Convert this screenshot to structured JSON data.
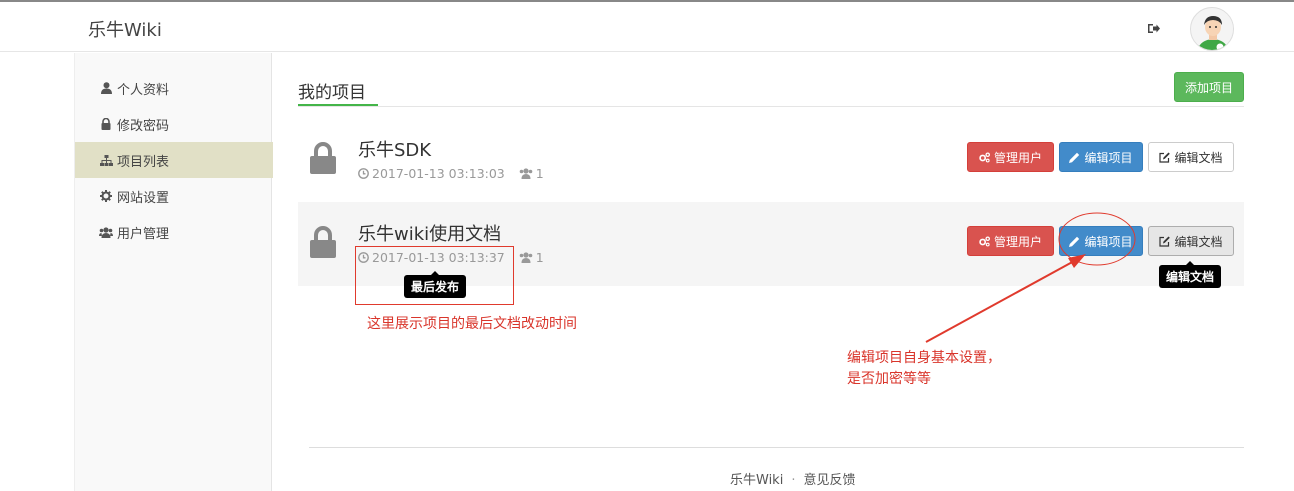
{
  "header": {
    "brand": "乐牛Wiki",
    "logout_icon": "sign-out-icon",
    "avatar_icon": "user-avatar"
  },
  "sidebar": {
    "items": [
      {
        "label": "个人资料",
        "icon": "user-icon"
      },
      {
        "label": "修改密码",
        "icon": "lock-icon"
      },
      {
        "label": "项目列表",
        "icon": "sitemap-icon",
        "active": true
      },
      {
        "label": "网站设置",
        "icon": "gear-icon"
      },
      {
        "label": "用户管理",
        "icon": "users-icon"
      }
    ]
  },
  "main": {
    "title": "我的项目",
    "add_button": "添加项目",
    "projects": [
      {
        "name": "乐牛SDK",
        "time": "2017-01-13 03:13:03",
        "members": "1",
        "manage_users": "管理用户",
        "edit_project": "编辑项目",
        "edit_docs": "编辑文档"
      },
      {
        "name": "乐牛wiki使用文档",
        "time": "2017-01-13 03:13:37",
        "members": "1",
        "manage_users": "管理用户",
        "edit_project": "编辑项目",
        "edit_docs": "编辑文档"
      }
    ],
    "tooltip_time": "最后发布",
    "tooltip_docs": "编辑文档"
  },
  "annotations": {
    "time_note": "这里展示项目的最后文档改动时间",
    "edit_note_line1": "编辑项目自身基本设置，",
    "edit_note_line2": "是否加密等等",
    "color": "#d9352b"
  },
  "footer": {
    "brand": "乐牛Wiki",
    "separator": "·",
    "feedback": "意见反馈"
  },
  "colors": {
    "active_sidebar": "#e1e0c6",
    "green": "#5cb85c",
    "red": "#d9534f",
    "blue": "#428bca"
  }
}
